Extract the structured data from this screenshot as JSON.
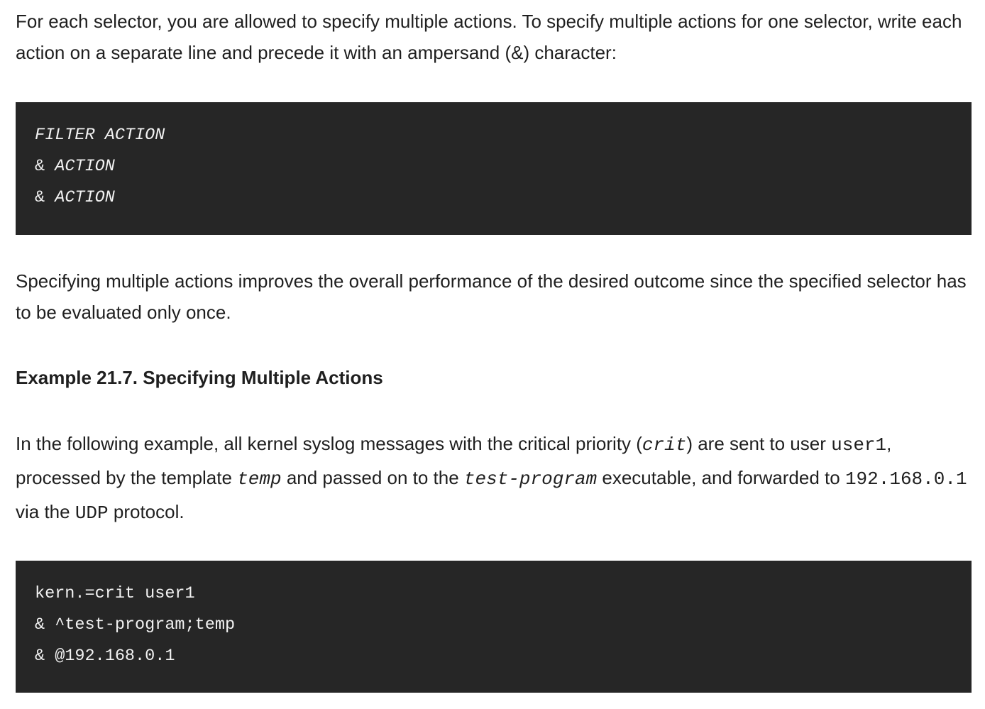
{
  "intro": {
    "text": "For each selector, you are allowed to specify multiple actions. To specify multiple actions for one selector, write each action on a separate line and precede it with an ampersand (&) character:"
  },
  "syntax_block": {
    "line1": "FILTER ACTION",
    "line2_amp": "& ",
    "line2_action": "ACTION",
    "line3_amp": "& ",
    "line3_action": "ACTION"
  },
  "performance": {
    "text": "Specifying multiple actions improves the overall performance of the desired outcome since the specified selector has to be evaluated only once."
  },
  "example": {
    "title": "Example 21.7. Specifying Multiple Actions",
    "t1": "In the following example, all kernel syslog messages with the critical priority (",
    "c1": "crit",
    "t2": ") are sent to user ",
    "c2": "user1",
    "t3": ", processed by the template ",
    "c3": "temp",
    "t4": " and passed on to the ",
    "c4": "test-program",
    "t5": " executable, and forwarded to ",
    "c5": "192.168.0.1",
    "t6": " via the ",
    "c6": "UDP",
    "t7": " protocol."
  },
  "example_block": {
    "line1": "kern.=crit user1",
    "line2": "& ^test-program;temp",
    "line3": "& @192.168.0.1"
  }
}
